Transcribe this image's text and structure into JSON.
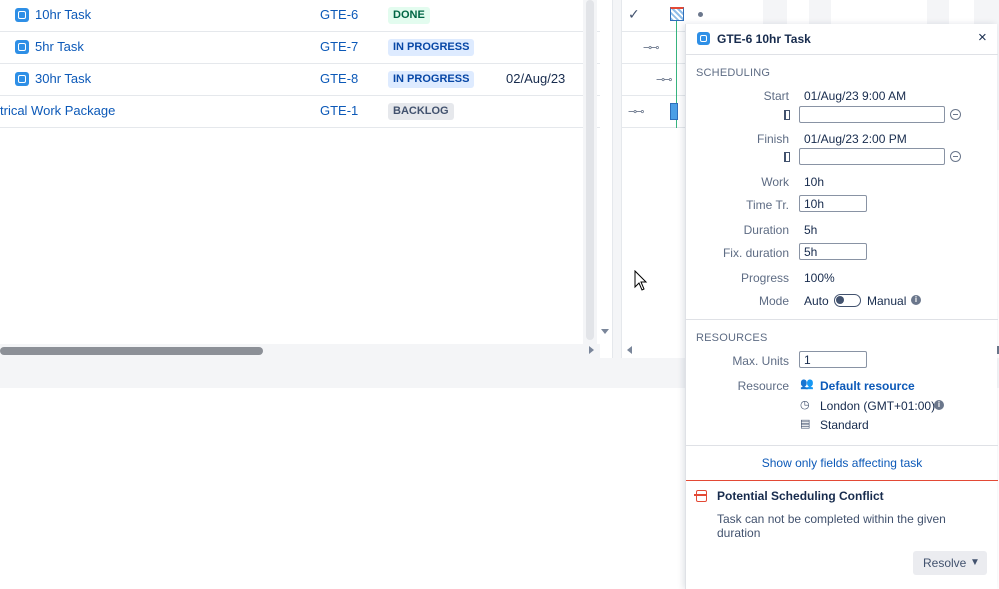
{
  "table": {
    "rows": [
      {
        "name": "10hr Task",
        "key": "GTE-6",
        "status": "DONE",
        "status_kind": "done",
        "date": ""
      },
      {
        "name": "5hr Task",
        "key": "GTE-7",
        "status": "IN PROGRESS",
        "status_kind": "progress",
        "date": ""
      },
      {
        "name": "30hr Task",
        "key": "GTE-8",
        "status": "IN PROGRESS",
        "status_kind": "progress",
        "date": "02/Aug/23"
      },
      {
        "name": "trical Work Package",
        "key": "GTE-1",
        "status": "BACKLOG",
        "status_kind": "backlog",
        "date": ""
      }
    ]
  },
  "panel": {
    "title": "GTE-6 10hr Task",
    "close_glyph": "×",
    "scheduling": {
      "title": "SCHEDULING",
      "start_label": "Start",
      "start_value": "01/Aug/23 9:00 AM",
      "start_input": "",
      "finish_label": "Finish",
      "finish_value": "01/Aug/23 2:00 PM",
      "finish_input": "",
      "work_label": "Work",
      "work_value": "10h",
      "time_tr_label": "Time Tr.",
      "time_tr_value": "10h",
      "duration_label": "Duration",
      "duration_value": "5h",
      "fix_duration_label": "Fix. duration",
      "fix_duration_value": "5h",
      "progress_label": "Progress",
      "progress_value": "100%",
      "mode_label": "Mode",
      "mode_auto": "Auto",
      "mode_manual": "Manual"
    },
    "resources": {
      "title": "RESOURCES",
      "max_units_label": "Max. Units",
      "max_units_value": "1",
      "resource_label": "Resource",
      "resource_name": "Default resource",
      "timezone": "London (GMT+01:00)",
      "calendar": "Standard"
    },
    "show_fields_link": "Show only fields affecting task",
    "conflict": {
      "title": "Potential Scheduling Conflict",
      "message": "Task can not be completed within the given duration",
      "resolve_label": "Resolve"
    }
  },
  "colors": {
    "link": "#0c59b8",
    "conflict": "#e34935",
    "today_line": "#36b37e",
    "task_icon": "#2e8fe6"
  }
}
